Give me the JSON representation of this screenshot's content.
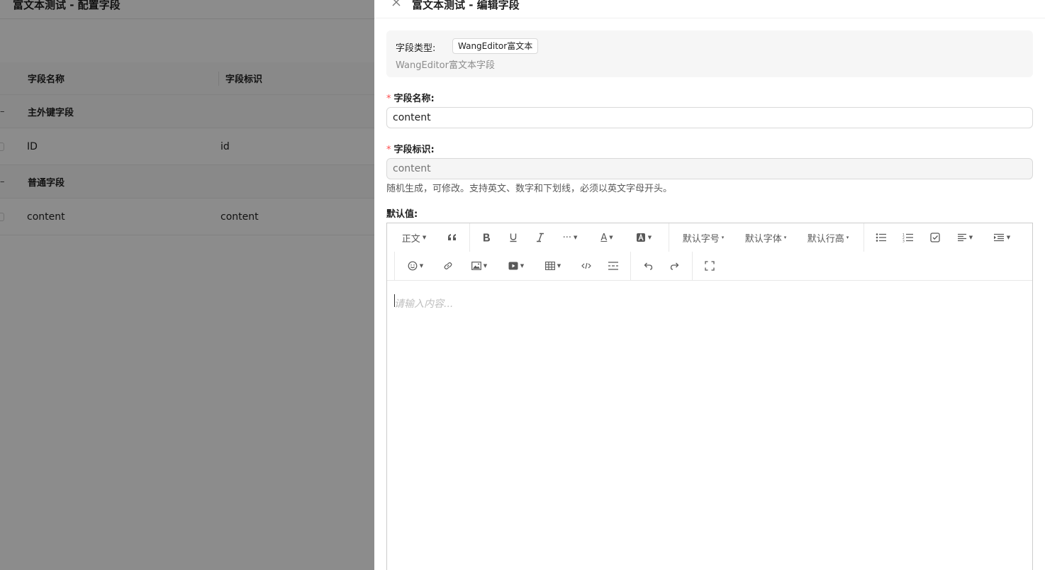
{
  "background": {
    "title": "富文本测试 - 配置字段",
    "columns": [
      "字段名称",
      "字段标识"
    ],
    "groups": [
      {
        "toggle": "–",
        "name": "主外键字段",
        "rows": [
          {
            "name": "ID",
            "key": "id"
          }
        ]
      },
      {
        "toggle": "–",
        "name": "普通字段",
        "rows": [
          {
            "name": "content",
            "key": "content"
          }
        ]
      }
    ]
  },
  "drawer": {
    "title": "富文本测试 - 编辑字段",
    "close_icon": "close-icon",
    "field_type": {
      "label": "字段类型:",
      "tag": "WangEditor富文本",
      "description": "WangEditor富文本字段"
    },
    "field_name": {
      "required_mark": "*",
      "label": "字段名称:",
      "value": "content"
    },
    "field_key": {
      "required_mark": "*",
      "label": "字段标识:",
      "placeholder": "content",
      "help": "随机生成，可修改。支持英文、数字和下划线，必须以英文字母开头。"
    },
    "default_value": {
      "label": "默认值:",
      "editor": {
        "placeholder": "请输入内容...",
        "toolbar": {
          "header": "正文",
          "font_size": "默认字号",
          "font_family": "默认字体",
          "line_height": "默认行高",
          "more": "···",
          "color": "A"
        }
      }
    }
  },
  "colors": {
    "required": "#ff4d4f",
    "mask": "rgba(0,0,0,0.45)",
    "muted_text": "#8c8c8c"
  }
}
